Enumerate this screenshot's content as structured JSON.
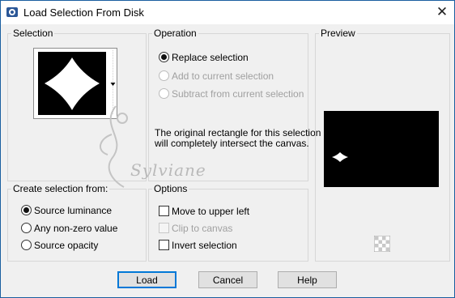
{
  "window": {
    "title": "Load Selection From Disk",
    "close_glyph": "✕"
  },
  "selection_group": {
    "label": "Selection"
  },
  "operation_group": {
    "label": "Operation",
    "options": [
      {
        "label": "Replace selection",
        "checked": true,
        "enabled": true
      },
      {
        "label": "Add to current selection",
        "checked": false,
        "enabled": false
      },
      {
        "label": "Subtract from current selection",
        "checked": false,
        "enabled": false
      }
    ],
    "info_line1": "The original rectangle for this selection",
    "info_line2": "will completely intersect the canvas."
  },
  "create_group": {
    "label": "Create selection from:",
    "options": [
      {
        "label": "Source luminance",
        "checked": true
      },
      {
        "label": "Any non-zero value",
        "checked": false
      },
      {
        "label": "Source opacity",
        "checked": false
      }
    ]
  },
  "options_group": {
    "label": "Options",
    "items": [
      {
        "label": "Move to upper left",
        "checked": false,
        "enabled": true
      },
      {
        "label": "Clip to canvas",
        "checked": false,
        "enabled": false
      },
      {
        "label": "Invert selection",
        "checked": false,
        "enabled": true
      }
    ]
  },
  "preview_group": {
    "label": "Preview"
  },
  "watermark": "Sylviane",
  "buttons": {
    "load": "Load",
    "cancel": "Cancel",
    "help": "Help"
  },
  "colors": {
    "accent": "#0078d7",
    "window_border": "#1a5fa0",
    "dialog_bg": "#f0f0f0",
    "preview_bg": "#000000"
  }
}
